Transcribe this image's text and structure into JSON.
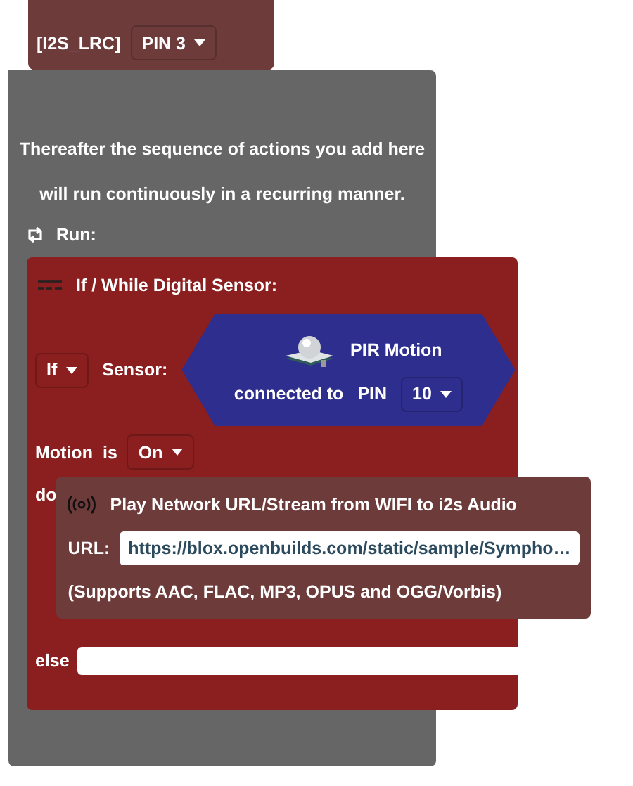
{
  "top_block": {
    "pin_label": "[I2S_LRC]",
    "pin": "PIN 3"
  },
  "loop_block": {
    "description": [
      "Thereafter the sequence of actions you add here",
      "will run continuously in a recurring manner."
    ],
    "run_label": "Run:"
  },
  "sensor_block": {
    "title": "If / While Digital Sensor:",
    "mode": "If",
    "sensor_label": "Sensor:",
    "sensor": {
      "name": "PIR Motion",
      "connected_label": "connected to",
      "pin_label": "PIN",
      "pin": "10"
    },
    "state_label": "Motion",
    "is_label": "is",
    "state": "On",
    "do_label": "do",
    "else_label": "else"
  },
  "audio_block": {
    "title": "Play Network URL/Stream from WIFI to i2s Audio",
    "url_label": "URL:",
    "url": "https://blox.openbuilds.com/static/sample/Sympho…",
    "note": "(Supports AAC, FLAC, MP3, OPUS and OGG/Vorbis)"
  }
}
